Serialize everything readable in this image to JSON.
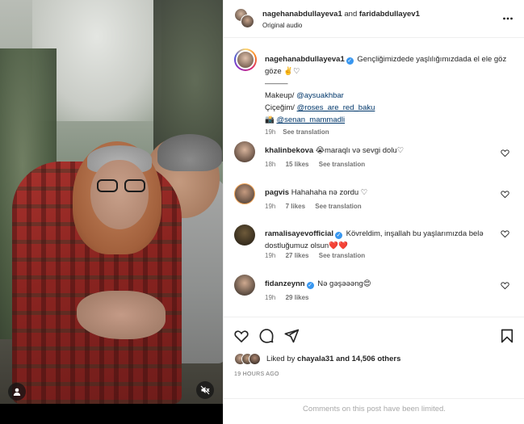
{
  "header": {
    "user1": "nagehanabdullayeva1",
    "joiner": "and",
    "user2": "faridabdullayev1",
    "audio": "Original audio"
  },
  "caption": {
    "username": "nagehanabdullayeva1",
    "text": "Gençliğimizdede yaşlılığımızdada el ele göz göze ✌️♡",
    "divider": "———",
    "makeup_label": "Makeup/",
    "makeup_mention": "@aysuakhbar",
    "flowers_label": "Çiçeğim/",
    "flowers_mention": "@roses_are_red_baku",
    "camera_emoji": "📸",
    "photo_mention": "@senan_mammadli",
    "time": "19h",
    "translation": "See translation"
  },
  "comments": [
    {
      "username": "khalinbekova",
      "verified": false,
      "text": "😭maraqlı və sevgi dolu♡",
      "time": "18h",
      "likes": "15 likes",
      "reply": "",
      "translation": "See translation"
    },
    {
      "username": "pagvis",
      "verified": false,
      "text": "Hahahaha nə zordu ♡",
      "time": "19h",
      "likes": "7 likes",
      "reply": "",
      "translation": "See translation"
    },
    {
      "username": "ramalisayevofficial",
      "verified": true,
      "text": "Kövreldim, inşallah bu yaşlarımızda belə dostluğumuz olsun❤️❤️",
      "time": "19h",
      "likes": "27 likes",
      "reply": "",
      "translation": "See translation"
    },
    {
      "username": "fidanzeynn",
      "verified": true,
      "text": "Nə gəşəəəng😍",
      "time": "19h",
      "likes": "29 likes",
      "reply": "",
      "translation": ""
    }
  ],
  "likes": {
    "prefix": "Liked by",
    "user": "chayala31",
    "suffix": "and 14,506 others"
  },
  "time_ago": "19 HOURS AGO",
  "comments_limited": "Comments on this post have been limited.",
  "icons": {
    "more": "more-options-icon",
    "like": "heart-icon",
    "comment": "comment-icon",
    "share": "share-icon",
    "save": "bookmark-icon",
    "mute": "mute-icon",
    "tagged": "user-tag-icon"
  },
  "colors": {
    "verified": "#3897f0",
    "mention": "#00376b",
    "muted_text": "#737373",
    "limited_text": "#a8a8a8"
  }
}
